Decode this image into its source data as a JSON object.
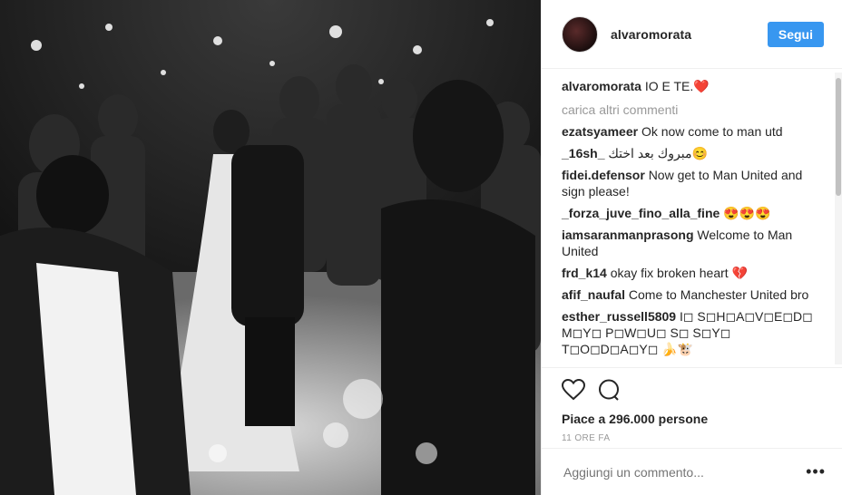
{
  "post": {
    "username": "alvaromorata",
    "follow_label": "Segui",
    "caption_user": "alvaromorata",
    "caption_text": "IO E TE.❤️",
    "load_more": "carica altri commenti",
    "likes": "Piace a 296.000 persone",
    "time": "11 ORE FA",
    "add_comment_placeholder": "Aggiungi un commento...",
    "more_label": "•••"
  },
  "comments": [
    {
      "user": "ezatsyameer",
      "text": "Ok now come to man utd"
    },
    {
      "user": "_16sh_",
      "text": "مبروك بعد اختك😊"
    },
    {
      "user": "fidei.defensor",
      "text": "Now get to Man United and sign please!"
    },
    {
      "user": "_forza_juve_fino_alla_fine",
      "text": "😍😍😍"
    },
    {
      "user": "iamsaranmanprasong",
      "text": "Welcome to Man United"
    },
    {
      "user": "frd_k14",
      "text": "okay fix broken heart 💔"
    },
    {
      "user": "afif_naufal",
      "text": "Come to Manchester United bro"
    },
    {
      "user": "esther_russell5809",
      "text": "I◻ S◻H◻A◻V◻E◻D◻ M◻Y◻ P◻W◻U◻ S◻ S◻Y◻ T◻O◻D◻A◻Y◻ 🍌🐮"
    }
  ],
  "icons": {
    "like": "heart-icon",
    "comment": "comment-icon"
  }
}
